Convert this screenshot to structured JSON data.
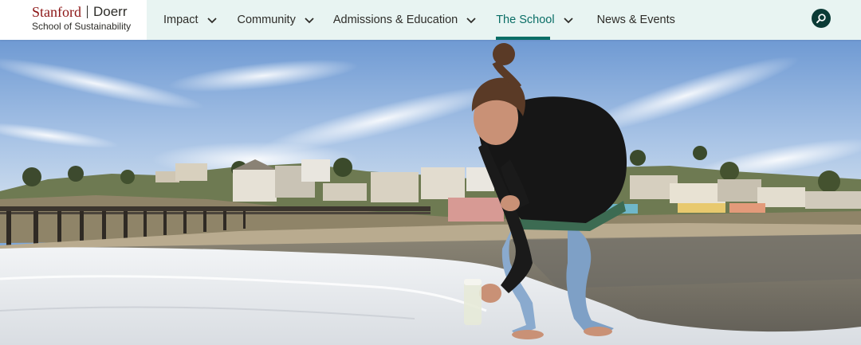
{
  "logo": {
    "stanford": "Stanford",
    "doerr": "Doerr",
    "subtitle": "School of Sustainability"
  },
  "nav": {
    "items": [
      {
        "label": "Impact",
        "has_dropdown": true,
        "active": false
      },
      {
        "label": "Community",
        "has_dropdown": true,
        "active": false
      },
      {
        "label": "Admissions & Education",
        "has_dropdown": true,
        "active": false
      },
      {
        "label": "The School",
        "has_dropdown": true,
        "active": true
      },
      {
        "label": "News & Events",
        "has_dropdown": false,
        "active": false
      }
    ]
  },
  "search": {
    "icon": "search-icon"
  },
  "hero": {
    "image": "researcher-sampling-seawater-photo"
  },
  "colors": {
    "header_bg": "#e8f4f2",
    "brand_red": "#8c1515",
    "accent_teal": "#0a6e66",
    "search_bg": "#0b3b36",
    "text": "#2e2d29"
  }
}
